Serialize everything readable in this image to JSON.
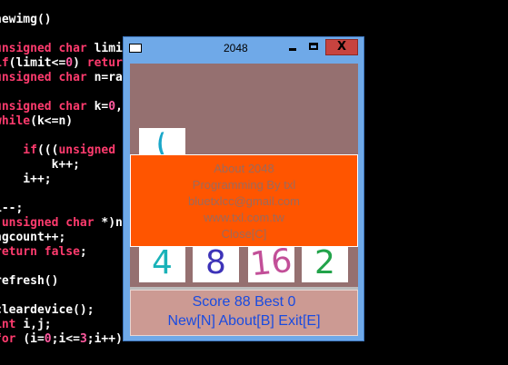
{
  "colors": {
    "desktop_bg": "#000000",
    "keyword": "#ff3b6e",
    "window_frame": "#6fa9e8",
    "board_bg": "#957070",
    "dialog_bg": "#ff5500",
    "dialog_text": "#9b6a5c",
    "status_bg": "#cc9a93",
    "status_text": "#1a4be0",
    "close_button": "#c7433f"
  },
  "code_lines": [
    {
      "segs": [
        {
          "t": "hewimg()",
          "c": "plain"
        }
      ]
    },
    {
      "segs": []
    },
    {
      "segs": [
        {
          "t": "unsigned char ",
          "c": "kw"
        },
        {
          "t": "limit",
          "c": "plain"
        }
      ]
    },
    {
      "segs": [
        {
          "t": "if",
          "c": "kw"
        },
        {
          "t": "(limit<=",
          "c": "plain"
        },
        {
          "t": "0",
          "c": "num"
        },
        {
          "t": ") ",
          "c": "plain"
        },
        {
          "t": "retur",
          "c": "kw"
        }
      ]
    },
    {
      "segs": [
        {
          "t": "unsigned char ",
          "c": "kw"
        },
        {
          "t": "n=ran",
          "c": "plain"
        }
      ]
    },
    {
      "segs": []
    },
    {
      "segs": [
        {
          "t": "unsigned char ",
          "c": "kw"
        },
        {
          "t": "k=",
          "c": "plain"
        },
        {
          "t": "0",
          "c": "num"
        },
        {
          "t": ",i",
          "c": "plain"
        }
      ]
    },
    {
      "segs": [
        {
          "t": "while",
          "c": "kw"
        },
        {
          "t": "(k<=n)",
          "c": "plain"
        }
      ]
    },
    {
      "segs": []
    },
    {
      "segs": [
        {
          "t": "    if",
          "c": "kw"
        },
        {
          "t": "(((",
          "c": "plain"
        },
        {
          "t": "unsigned c",
          "c": "kw"
        }
      ]
    },
    {
      "segs": [
        {
          "t": "        k++;",
          "c": "plain"
        }
      ]
    },
    {
      "segs": [
        {
          "t": "    i++;",
          "c": "plain"
        }
      ]
    },
    {
      "segs": []
    },
    {
      "segs": [
        {
          "t": "i--;",
          "c": "plain"
        }
      ]
    },
    {
      "segs": [
        {
          "t": "(",
          "c": "plain"
        },
        {
          "t": "unsigned char ",
          "c": "kw"
        },
        {
          "t": "*)n",
          "c": "plain"
        }
      ]
    },
    {
      "segs": [
        {
          "t": "ngcount++;",
          "c": "plain"
        }
      ]
    },
    {
      "segs": [
        {
          "t": "return false",
          "c": "kw"
        },
        {
          "t": ";",
          "c": "plain"
        }
      ]
    },
    {
      "segs": []
    },
    {
      "segs": [
        {
          "t": "refresh()",
          "c": "plain"
        }
      ]
    },
    {
      "segs": []
    },
    {
      "segs": [
        {
          "t": "cleardevice();",
          "c": "plain"
        }
      ]
    },
    {
      "segs": [
        {
          "t": "int ",
          "c": "kw"
        },
        {
          "t": "i,j;",
          "c": "plain"
        }
      ]
    },
    {
      "segs": [
        {
          "t": "for ",
          "c": "kw"
        },
        {
          "t": "(i=",
          "c": "plain"
        },
        {
          "t": "0",
          "c": "num"
        },
        {
          "t": ";i<=",
          "c": "plain"
        },
        {
          "t": "3",
          "c": "num"
        },
        {
          "t": ";i++)",
          "c": "plain"
        }
      ]
    }
  ],
  "window": {
    "title": "2048",
    "close_glyph": "X"
  },
  "tiles": [
    {
      "text": "(",
      "color": "#1aa7c9",
      "rotate": "-8deg"
    },
    {
      "text": "4",
      "color": "#19b2b8",
      "rotate": "0deg"
    },
    {
      "text": "8",
      "color": "#3d33b8",
      "rotate": "0deg"
    },
    {
      "text": "16",
      "color": "#c24f98",
      "rotate": "-6deg"
    },
    {
      "text": "2",
      "color": "#22a34a",
      "rotate": "0deg"
    }
  ],
  "dialog": {
    "lines": [
      "About 2048",
      "Programming By txl",
      "bluetxlcc@gmail.com",
      "www.txl.com.tw",
      "Close[C]"
    ]
  },
  "status": {
    "score_line": "Score 88  Best 0",
    "menu_line": "New[N]  About[B]  Exit[E]"
  }
}
